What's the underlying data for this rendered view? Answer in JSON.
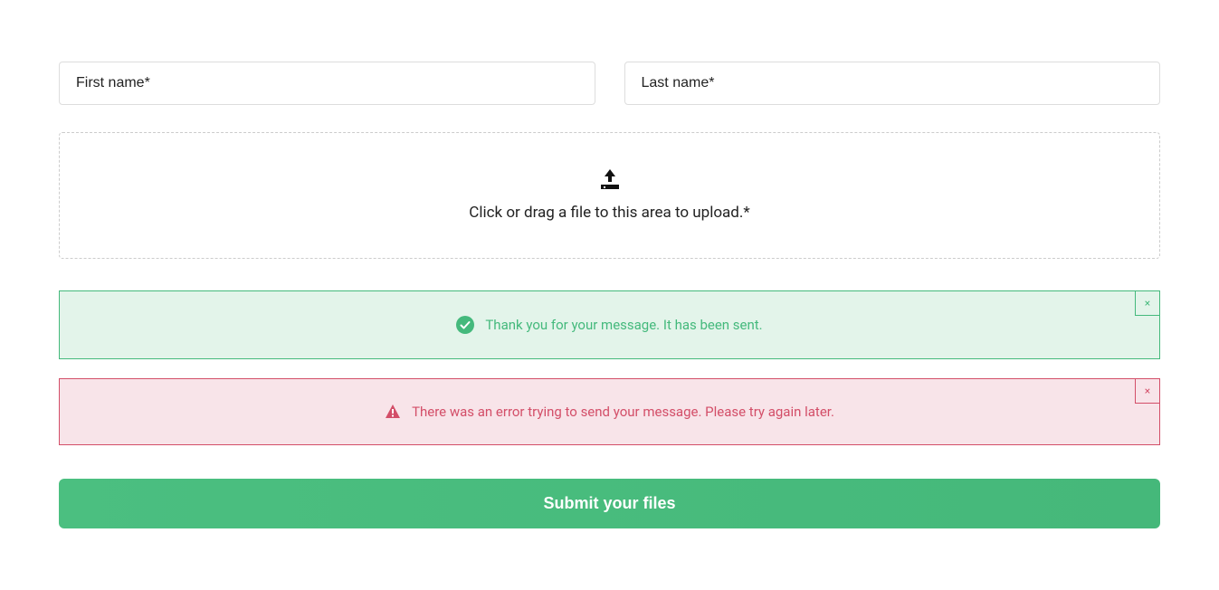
{
  "form": {
    "first_name_placeholder": "First name*",
    "first_name_value": "",
    "last_name_placeholder": "Last name*",
    "last_name_value": "",
    "upload_text": "Click or drag a file to this area to upload.*",
    "submit_label": "Submit your files"
  },
  "alerts": {
    "success_text": "Thank you for your message. It has been sent.",
    "error_text": "There was an error trying to send your message. Please try again later.",
    "close_label": "×"
  }
}
